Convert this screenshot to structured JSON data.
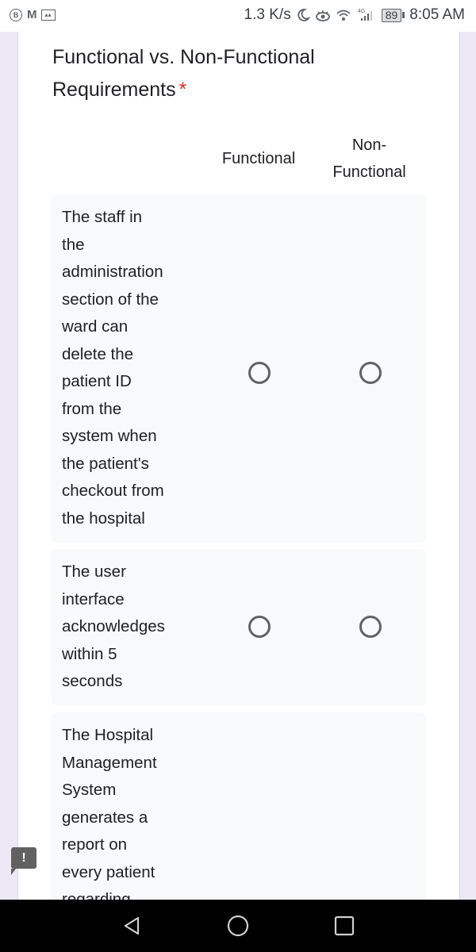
{
  "status_bar": {
    "left_icons": [
      "b-messenger-icon",
      "gmail-icon",
      "image-notification-icon"
    ],
    "network_speed": "1.3 K/s",
    "right_icons": [
      "do-not-disturb-moon-icon",
      "eye-comfort-icon",
      "wifi-icon",
      "signal-4g-icon"
    ],
    "network_type": "4G",
    "battery_level": "89",
    "time": "8:05 AM"
  },
  "question": {
    "title": "Functional vs. Non-Functional Requirements",
    "title_line1": "Functional vs. Non-Functional",
    "title_line2": "Requirements",
    "required_marker": "*",
    "required_color": "#d93025",
    "columns": [
      {
        "label": "Functional"
      },
      {
        "label_line1": "Non-",
        "label_line2": "Functional",
        "label": "Non-Functional"
      }
    ],
    "rows": [
      {
        "text": "The staff in the administration section of the ward can delete the patient ID from the system when the patient's checkout from the hospital",
        "lines": [
          "The staff in",
          "the",
          "administration",
          "section of the",
          "ward can",
          "delete the",
          "patient ID",
          "from the",
          "system when",
          "the patient's",
          "checkout from",
          "the hospital"
        ],
        "selected": null
      },
      {
        "text": "The user interface acknowledges within 5 seconds",
        "lines": [
          "The user",
          "interface",
          "acknowledges",
          "within 5",
          "seconds"
        ],
        "selected": null
      },
      {
        "text": "The Hospital Management System generates a report on every patient regarding",
        "lines": [
          "The Hospital",
          "Management",
          "System",
          "generates a",
          "report on",
          "every patient",
          "regarding"
        ],
        "selected": null
      }
    ]
  },
  "feedback_button": {
    "icon": "exclamation-feedback-icon",
    "label": "!"
  },
  "nav_bar": {
    "buttons": [
      "back",
      "home",
      "recents"
    ]
  }
}
